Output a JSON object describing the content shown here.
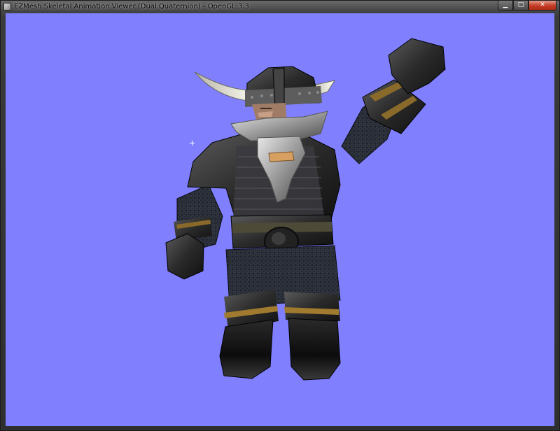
{
  "window": {
    "title": "EZMesh Skeletal Animation Viewer (Dual Quaternion) - OpenGL 3.3",
    "app_icon": "app-icon",
    "caption_buttons": {
      "minimize": "minimize-icon",
      "maximize": "maximize-icon",
      "close": "close-icon"
    }
  },
  "viewport": {
    "background_color": "#8080ff",
    "model": "dwarf",
    "cursor": "crosshair"
  }
}
